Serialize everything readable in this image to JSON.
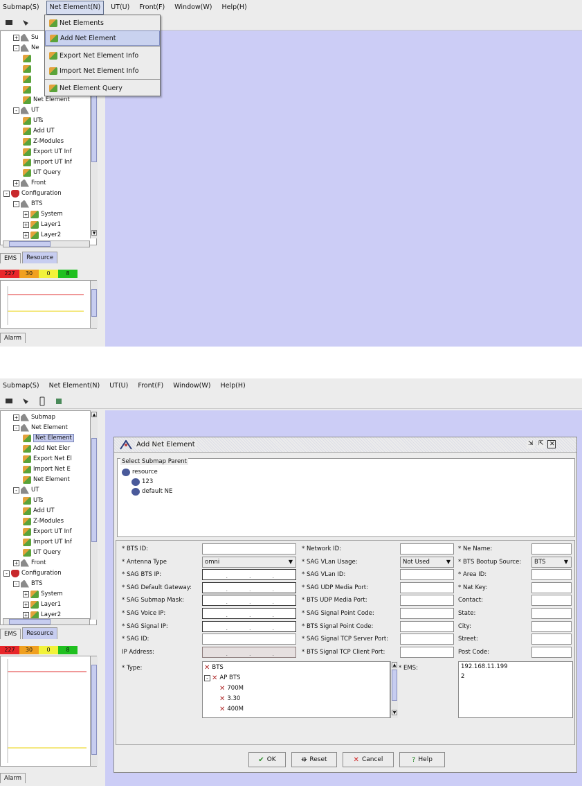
{
  "menubar": {
    "items": [
      "Submap(S)",
      "Net Element(N)",
      "UT(U)",
      "Front(F)",
      "Window(W)",
      "Help(H)"
    ]
  },
  "screen1": {
    "dropdown": {
      "items": [
        "Net Elements",
        "Add Net Element",
        "Export Net Element Info",
        "Import Net Element Info",
        "Net Element Query"
      ],
      "highlighted": "Add Net Element"
    },
    "tree": {
      "rows": [
        {
          "text": "Su",
          "icon": "folder-icon",
          "level": 1,
          "exp": "+"
        },
        {
          "text": "Ne",
          "icon": "folder-icon",
          "level": 1,
          "exp": "-"
        },
        {
          "text": "",
          "icon": "wand-icon",
          "level": 2
        },
        {
          "text": "",
          "icon": "wand-icon",
          "level": 2
        },
        {
          "text": "",
          "icon": "wand-icon",
          "level": 2
        },
        {
          "text": "",
          "icon": "wand-icon",
          "level": 2
        },
        {
          "text": "Net Element",
          "icon": "wand-icon",
          "level": 2
        },
        {
          "text": "UT",
          "icon": "folder-icon",
          "level": 1,
          "exp": "-"
        },
        {
          "text": "UTs",
          "icon": "wand-icon",
          "level": 2
        },
        {
          "text": "Add UT",
          "icon": "wand-icon",
          "level": 2
        },
        {
          "text": "Z-Modules",
          "icon": "wand-icon",
          "level": 2
        },
        {
          "text": "Export UT Inf",
          "icon": "wand-icon",
          "level": 2
        },
        {
          "text": "Import UT Inf",
          "icon": "wand-icon",
          "level": 2
        },
        {
          "text": "UT Query",
          "icon": "wand-icon",
          "level": 2
        },
        {
          "text": "Front",
          "icon": "folder-icon",
          "level": 1,
          "exp": "+"
        },
        {
          "text": "Configuration",
          "icon": "config-icon",
          "level": 0,
          "exp": "-"
        },
        {
          "text": "BTS",
          "icon": "folder-icon",
          "level": 1,
          "exp": "-"
        },
        {
          "text": "System",
          "icon": "wand-icon",
          "level": 2,
          "exp": "+"
        },
        {
          "text": "Layer1",
          "icon": "wand-icon",
          "level": 2,
          "exp": "+"
        },
        {
          "text": "Layer2",
          "icon": "wand-icon",
          "level": 2,
          "exp": "+"
        }
      ]
    }
  },
  "tabs": {
    "ems": "EMS",
    "resource": "Resource",
    "alarm": "Alarm"
  },
  "alarm_counts": [
    {
      "value": "227",
      "color": "#e8262a"
    },
    {
      "value": "30",
      "color": "#f0a020"
    },
    {
      "value": "0",
      "color": "#f2f23a"
    },
    {
      "value": "8",
      "color": "#20c020"
    }
  ],
  "screen2": {
    "tree": {
      "rows": [
        {
          "text": "Submap",
          "icon": "folder-icon",
          "level": 1,
          "exp": "+"
        },
        {
          "text": "Net Element",
          "icon": "folder-icon",
          "level": 1,
          "exp": "-"
        },
        {
          "text": "Net Element",
          "icon": "wand-icon",
          "level": 2,
          "selected": true
        },
        {
          "text": "Add Net Eler",
          "icon": "wand-icon",
          "level": 2
        },
        {
          "text": "Export Net El",
          "icon": "wand-icon",
          "level": 2
        },
        {
          "text": "Import Net E",
          "icon": "wand-icon",
          "level": 2
        },
        {
          "text": "Net Element",
          "icon": "wand-icon",
          "level": 2
        },
        {
          "text": "UT",
          "icon": "folder-icon",
          "level": 1,
          "exp": "-"
        },
        {
          "text": "UTs",
          "icon": "wand-icon",
          "level": 2
        },
        {
          "text": "Add UT",
          "icon": "wand-icon",
          "level": 2
        },
        {
          "text": "Z-Modules",
          "icon": "wand-icon",
          "level": 2
        },
        {
          "text": "Export UT Inf",
          "icon": "wand-icon",
          "level": 2
        },
        {
          "text": "Import UT Inf",
          "icon": "wand-icon",
          "level": 2
        },
        {
          "text": "UT Query",
          "icon": "wand-icon",
          "level": 2
        },
        {
          "text": "Front",
          "icon": "folder-icon",
          "level": 1,
          "exp": "+"
        },
        {
          "text": "Configuration",
          "icon": "config-icon",
          "level": 0,
          "exp": "-"
        },
        {
          "text": "BTS",
          "icon": "folder-icon",
          "level": 1,
          "exp": "-"
        },
        {
          "text": "System",
          "icon": "wand-icon",
          "level": 2,
          "exp": "+"
        },
        {
          "text": "Layer1",
          "icon": "wand-icon",
          "level": 2,
          "exp": "+"
        },
        {
          "text": "Layer2",
          "icon": "wand-icon",
          "level": 2,
          "exp": "+"
        }
      ]
    },
    "dialog": {
      "title": "Add Net Element",
      "submap_group_title": "Select Submap Parent",
      "submap_tree": [
        "resource",
        "123",
        "default NE"
      ],
      "col1": [
        {
          "label": "* BTS ID:",
          "kind": "text",
          "value": ""
        },
        {
          "label": "* Antenna Type",
          "kind": "select",
          "value": "omni"
        },
        {
          "label": "* SAG BTS IP:",
          "kind": "ip",
          "value": ""
        },
        {
          "label": "* SAG Default Gateway:",
          "kind": "ip",
          "value": ""
        },
        {
          "label": "* SAG Submap Mask:",
          "kind": "ip",
          "value": ""
        },
        {
          "label": "* SAG Voice IP:",
          "kind": "ip",
          "value": ""
        },
        {
          "label": "* SAG Signal IP:",
          "kind": "ip",
          "value": ""
        },
        {
          "label": "* SAG ID:",
          "kind": "text",
          "value": ""
        },
        {
          "label": "IP Address:",
          "kind": "ipgrey",
          "value": ""
        }
      ],
      "col2": [
        {
          "label": "* Network ID:",
          "kind": "text",
          "value": ""
        },
        {
          "label": "* SAG VLan Usage:",
          "kind": "select",
          "value": "Not Used"
        },
        {
          "label": "* SAG VLan ID:",
          "kind": "text",
          "value": ""
        },
        {
          "label": "* SAG UDP Media Port:",
          "kind": "text",
          "value": ""
        },
        {
          "label": "* BTS UDP Media Port:",
          "kind": "text",
          "value": ""
        },
        {
          "label": "* SAG Signal Point Code:",
          "kind": "text",
          "value": ""
        },
        {
          "label": "* BTS Signal Point Code:",
          "kind": "text",
          "value": ""
        },
        {
          "label": "* SAG Signal TCP Server Port:",
          "kind": "text",
          "value": ""
        },
        {
          "label": "* BTS Signal TCP Client Port:",
          "kind": "text",
          "value": ""
        }
      ],
      "col3": [
        {
          "label": "* Ne Name:",
          "kind": "text",
          "value": ""
        },
        {
          "label": "* BTS Bootup Source:",
          "kind": "select",
          "value": "BTS"
        },
        {
          "label": "* Area ID:",
          "kind": "text",
          "value": ""
        },
        {
          "label": "* Nat Key:",
          "kind": "text",
          "value": ""
        },
        {
          "label": "Contact:",
          "kind": "text",
          "value": ""
        },
        {
          "label": "State:",
          "kind": "text",
          "value": ""
        },
        {
          "label": "City:",
          "kind": "text",
          "value": ""
        },
        {
          "label": "Street:",
          "kind": "text",
          "value": ""
        },
        {
          "label": "Post Code:",
          "kind": "text",
          "value": ""
        }
      ],
      "type_label": "* Type:",
      "type_tree": [
        {
          "text": "BTS",
          "level": 0
        },
        {
          "text": "AP BTS",
          "level": 0,
          "exp": "-"
        },
        {
          "text": "700M",
          "level": 1
        },
        {
          "text": "3.30",
          "level": 1
        },
        {
          "text": "400M",
          "level": 1
        }
      ],
      "ems_label": "* EMS:",
      "ems_values": [
        "192.168.11.199",
        "2"
      ],
      "buttons": {
        "ok": "OK",
        "reset": "Reset",
        "cancel": "Cancel",
        "help": "Help"
      }
    }
  },
  "colors": {
    "desktop": "#cccdf6",
    "selection": "#c7cdf0"
  }
}
